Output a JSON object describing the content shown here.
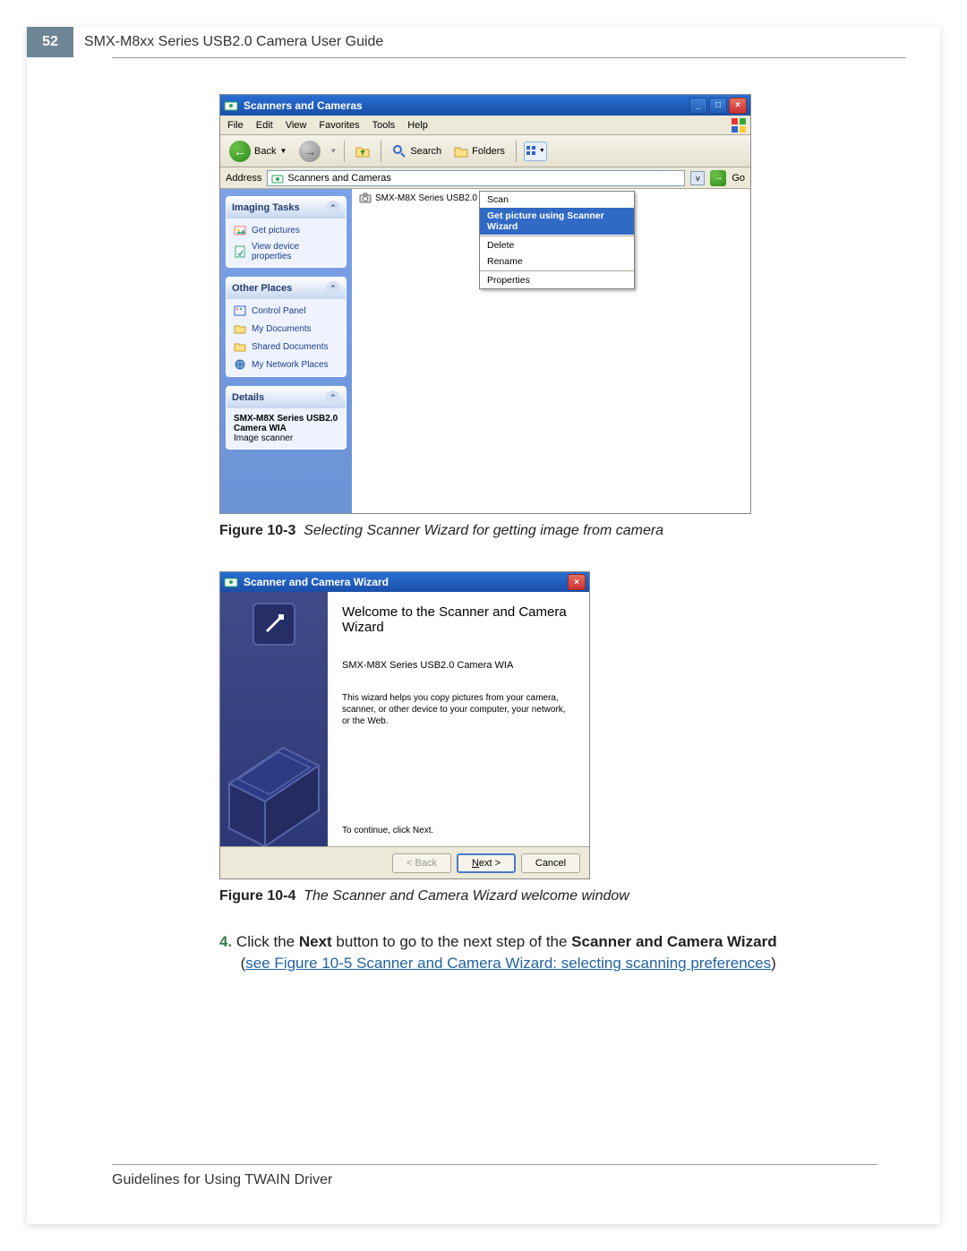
{
  "page": {
    "number": "52",
    "header_title": "SMX-M8xx Series USB2.0 Camera User Guide",
    "footer_text": "Guidelines for Using TWAIN Driver"
  },
  "fig1": {
    "window_title": "Scanners and Cameras",
    "menu": {
      "file": "File",
      "edit": "Edit",
      "view": "View",
      "favorites": "Favorites",
      "tools": "Tools",
      "help": "Help"
    },
    "toolbar": {
      "back": "Back",
      "search": "Search",
      "folders": "Folders"
    },
    "address": {
      "label": "Address",
      "value": "Scanners and Cameras",
      "go": "Go"
    },
    "side": {
      "imaging": {
        "title": "Imaging Tasks",
        "items": [
          "Get pictures",
          "View device properties"
        ]
      },
      "other": {
        "title": "Other Places",
        "items": [
          "Control Panel",
          "My Documents",
          "Shared Documents",
          "My Network Places"
        ]
      },
      "details": {
        "title": "Details",
        "name": "SMX-M8X Series USB2.0 Camera WIA",
        "type": "Image scanner"
      }
    },
    "file_label": "SMX-M8X Series USB2.0 Camera WIA",
    "ctx": {
      "scan": "Scan",
      "wizard": "Get picture using Scanner Wizard",
      "delete": "Delete",
      "rename": "Rename",
      "properties": "Properties"
    },
    "caption_bold": "Figure 10-3",
    "caption_italic": "Selecting Scanner Wizard for getting image from camera"
  },
  "fig2": {
    "window_title": "Scanner and Camera Wizard",
    "heading": "Welcome to the Scanner and Camera Wizard",
    "device": "SMX-M8X Series USB2.0 Camera WIA",
    "desc": "This wizard helps you copy pictures from your camera, scanner, or other device to your computer, your network, or the Web.",
    "cont": "To continue, click Next.",
    "buttons": {
      "back": "< Back",
      "next": "Next >",
      "cancel": "Cancel"
    },
    "caption_bold": "Figure 10-4",
    "caption_italic": "The Scanner and Camera Wizard welcome window"
  },
  "step4": {
    "num": "4.",
    "part1": "Click the ",
    "b1": "Next",
    "part2": " button to go to the next step of the ",
    "b2": "Scanner and Camera Wizard",
    "link_pre": "(",
    "link": "see Figure 10-5 Scanner and Camera Wizard: selecting scanning preferences",
    "link_post": ")"
  }
}
